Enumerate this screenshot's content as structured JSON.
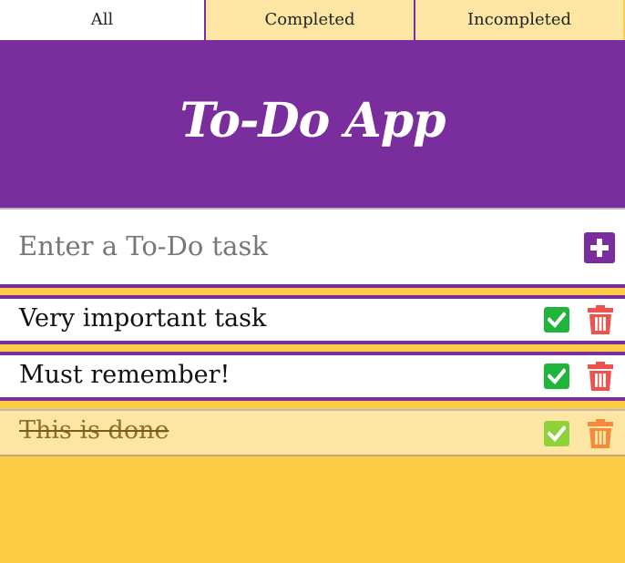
{
  "tabs": [
    {
      "label": "All",
      "active": true
    },
    {
      "label": "Completed",
      "active": false
    },
    {
      "label": "Incompleted",
      "active": false
    }
  ],
  "header": {
    "title": "To-Do App"
  },
  "input": {
    "placeholder": "Enter a To-Do task",
    "value": ""
  },
  "tasks": [
    {
      "text": "Very important task",
      "completed": false
    },
    {
      "text": "Must remember!",
      "completed": false
    },
    {
      "text": "This is done",
      "completed": true
    }
  ],
  "colors": {
    "purple": "#7a2d9c",
    "yellow": "#fdcd46",
    "light_yellow": "#fde6a3",
    "check_green": "#1fb53b",
    "trash_red": "#f2504b",
    "trash_orange": "#f58a3c"
  },
  "icons": {
    "add": "plus-square-icon",
    "complete": "check-square-icon",
    "delete": "trash-icon"
  }
}
